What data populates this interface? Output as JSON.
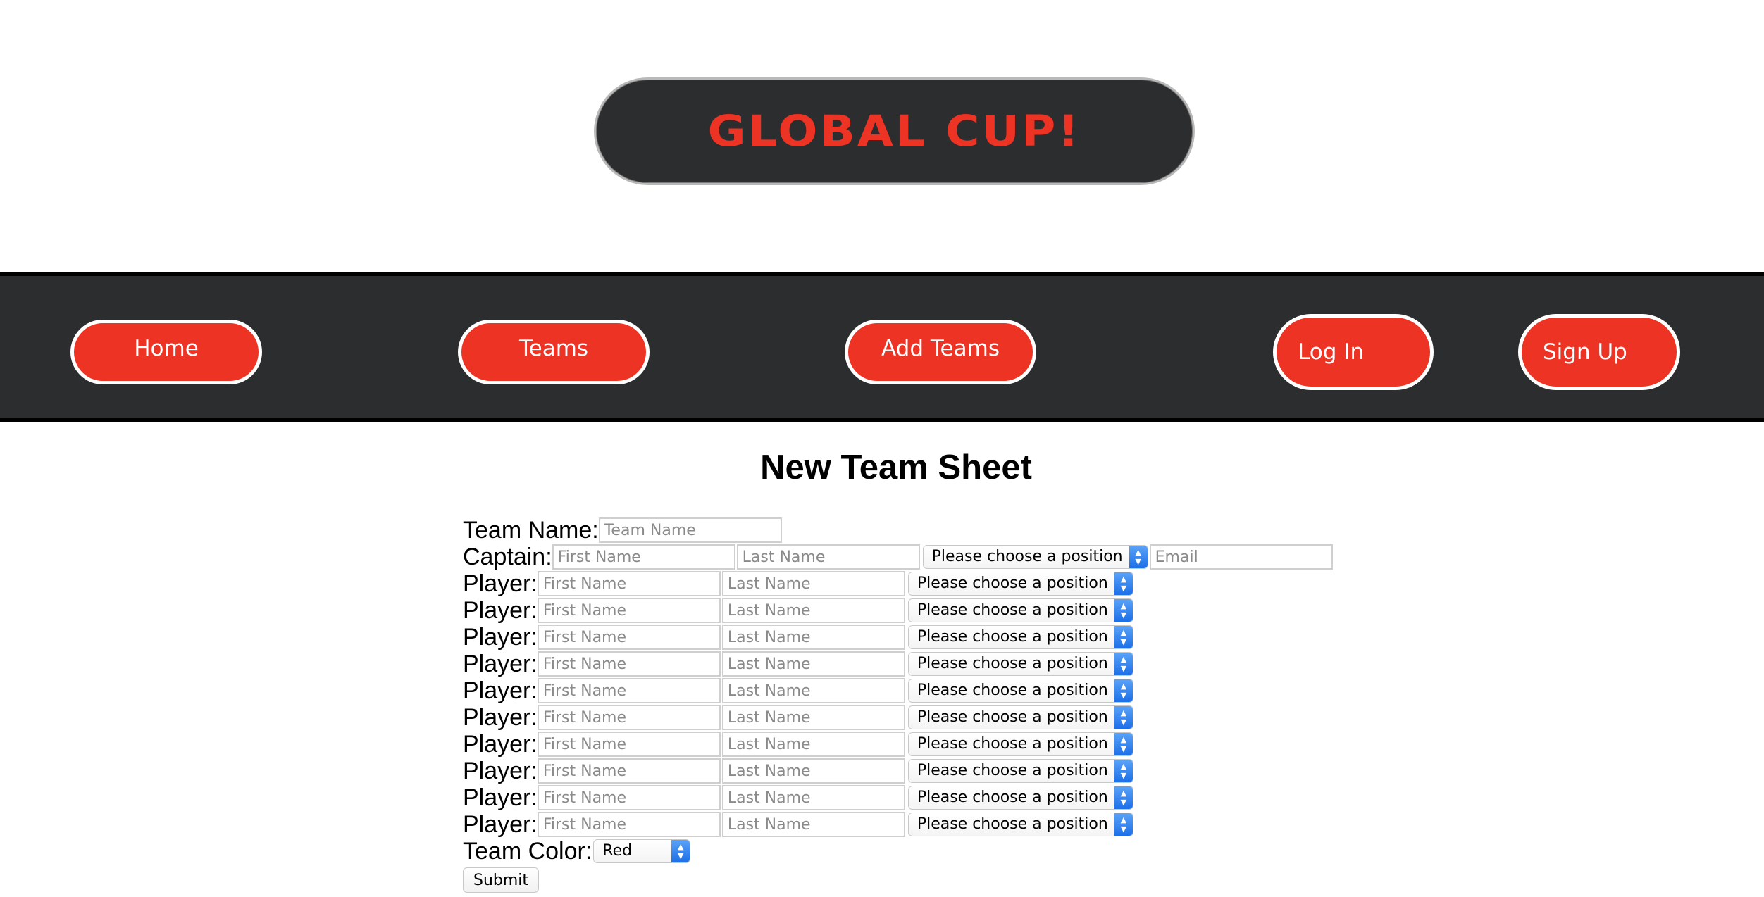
{
  "header": {
    "logo_text": "GLOBAL CUP!"
  },
  "nav": {
    "home": "Home",
    "teams": "Teams",
    "add_teams": "Add Teams",
    "log_in": "Log In",
    "sign_up": "Sign Up"
  },
  "colors": {
    "brand_red": "#ec3324",
    "dark_bg": "#2c2d2f",
    "select_accent": "#1c6fe8"
  },
  "page_title": "New Team Sheet",
  "form": {
    "team_name": {
      "label": "Team Name:",
      "placeholder": "Team Name",
      "value": ""
    },
    "captain": {
      "label": "Captain:",
      "first_placeholder": "First Name",
      "last_placeholder": "Last Name",
      "position": "Please choose a position",
      "email_placeholder": "Email"
    },
    "players": [
      {
        "label": "Player:",
        "first_placeholder": "First Name",
        "last_placeholder": "Last Name",
        "position": "Please choose a position"
      },
      {
        "label": "Player:",
        "first_placeholder": "First Name",
        "last_placeholder": "Last Name",
        "position": "Please choose a position"
      },
      {
        "label": "Player:",
        "first_placeholder": "First Name",
        "last_placeholder": "Last Name",
        "position": "Please choose a position"
      },
      {
        "label": "Player:",
        "first_placeholder": "First Name",
        "last_placeholder": "Last Name",
        "position": "Please choose a position"
      },
      {
        "label": "Player:",
        "first_placeholder": "First Name",
        "last_placeholder": "Last Name",
        "position": "Please choose a position"
      },
      {
        "label": "Player:",
        "first_placeholder": "First Name",
        "last_placeholder": "Last Name",
        "position": "Please choose a position"
      },
      {
        "label": "Player:",
        "first_placeholder": "First Name",
        "last_placeholder": "Last Name",
        "position": "Please choose a position"
      },
      {
        "label": "Player:",
        "first_placeholder": "First Name",
        "last_placeholder": "Last Name",
        "position": "Please choose a position"
      },
      {
        "label": "Player:",
        "first_placeholder": "First Name",
        "last_placeholder": "Last Name",
        "position": "Please choose a position"
      },
      {
        "label": "Player:",
        "first_placeholder": "First Name",
        "last_placeholder": "Last Name",
        "position": "Please choose a position"
      }
    ],
    "team_color": {
      "label": "Team Color:",
      "value": "Red"
    },
    "submit_label": "Submit"
  }
}
